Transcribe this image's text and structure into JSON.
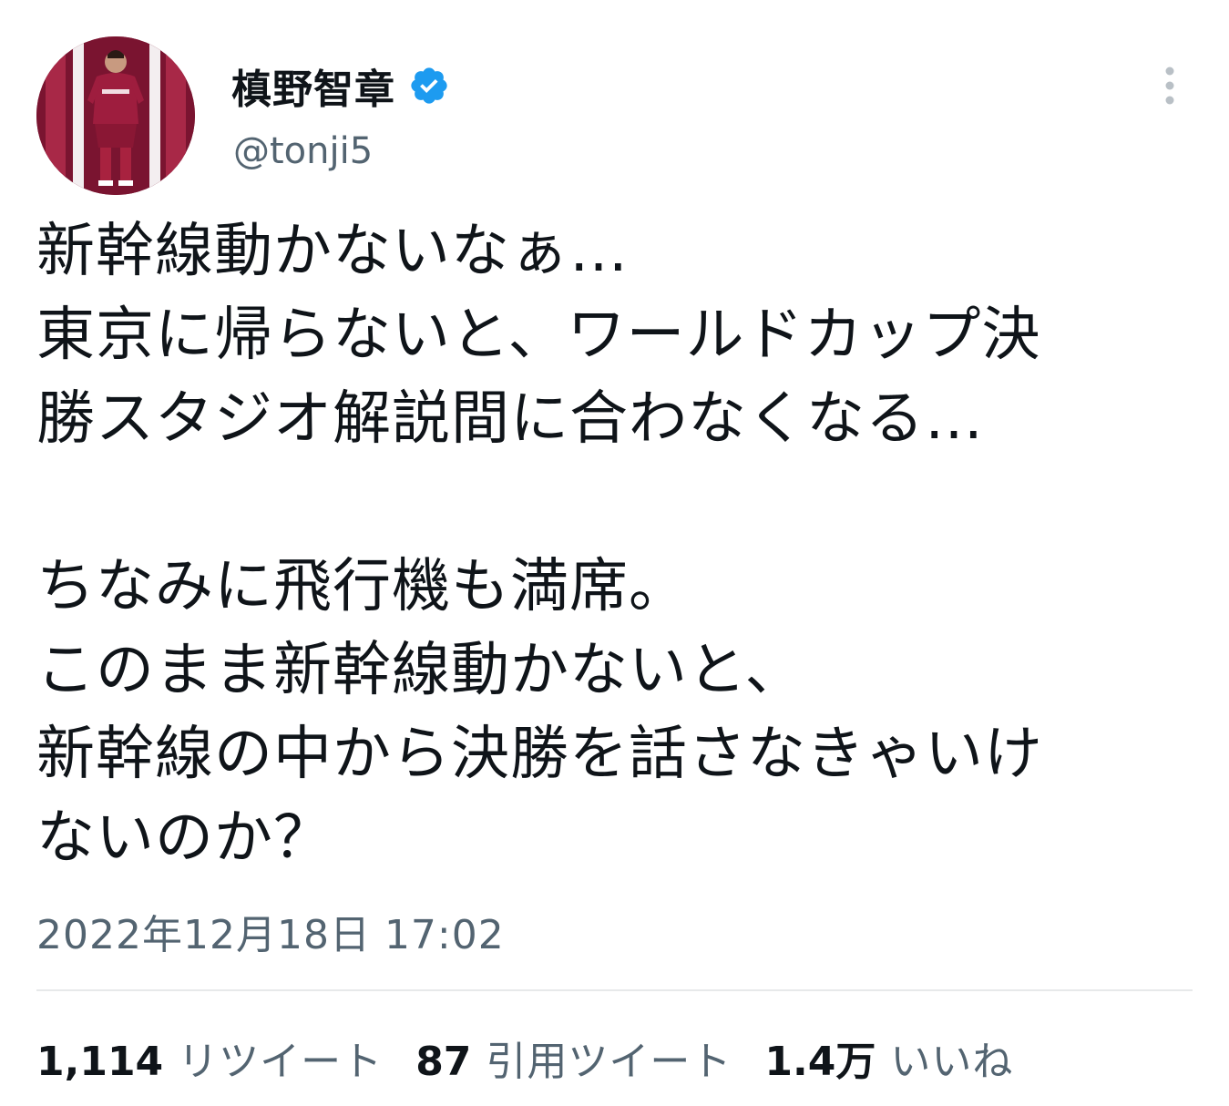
{
  "user": {
    "display_name": "槙野智章",
    "handle": "@tonji5",
    "verified": true
  },
  "icons": {
    "avatar": "avatar",
    "verified": "verified-badge-icon",
    "more": "more-options-icon"
  },
  "colors": {
    "verified_blue": "#1d9bf0",
    "secondary_text": "#536471",
    "avatar_bg": "#8a1734"
  },
  "tweet": {
    "lines": [
      "新幹線動かないなぁ…",
      "東京に帰らないと、ワールドカップ決",
      "勝スタジオ解説間に合わなくなる…",
      "",
      "ちなみに飛行機も満席。",
      "このまま新幹線動かないと、",
      "新幹線の中から決勝を話さなきゃいけ",
      "ないのか？"
    ],
    "timestamp": "2022年12月18日 17:02"
  },
  "stats": {
    "retweets": {
      "count": "1,114",
      "label": "リツイート"
    },
    "quotes": {
      "count": "87",
      "label": "引用ツイート"
    },
    "likes": {
      "count": "1.4万",
      "label": "いいね"
    }
  }
}
